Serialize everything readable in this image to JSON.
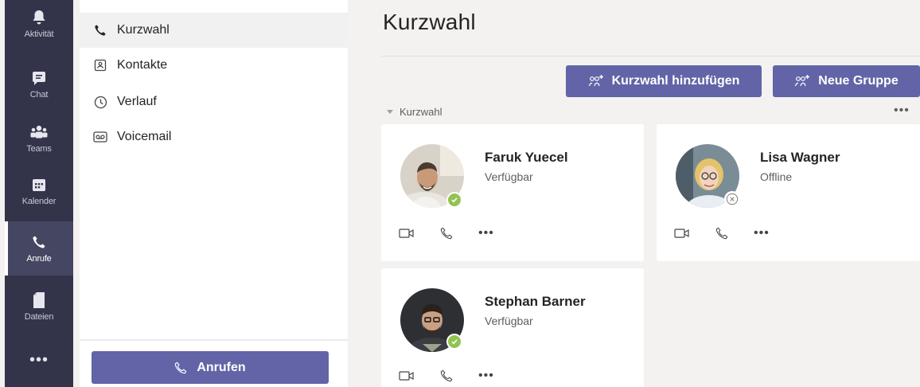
{
  "rail": {
    "items": [
      {
        "label": "Aktivität",
        "icon": "bell-icon"
      },
      {
        "label": "Chat",
        "icon": "chat-icon"
      },
      {
        "label": "Teams",
        "icon": "teams-icon"
      },
      {
        "label": "Kalender",
        "icon": "calendar-icon"
      },
      {
        "label": "Anrufe",
        "icon": "phone-icon",
        "active": true
      },
      {
        "label": "Dateien",
        "icon": "file-icon"
      }
    ],
    "more_label": "•••"
  },
  "nav": {
    "items": [
      {
        "label": "Kurzwahl",
        "icon": "phone-icon"
      },
      {
        "label": "Kontakte",
        "icon": "contact-card-icon"
      },
      {
        "label": "Verlauf",
        "icon": "clock-icon"
      },
      {
        "label": "Voicemail",
        "icon": "voicemail-icon"
      }
    ],
    "call_button_label": "Anrufen"
  },
  "main": {
    "title": "Kurzwahl",
    "add_speed_dial_label": "Kurzwahl hinzufügen",
    "new_group_label": "Neue Gruppe",
    "section_label": "Kurzwahl",
    "section_more": "•••",
    "contacts": [
      {
        "name": "Faruk Yuecel",
        "status": "Verfügbar",
        "presence": "available"
      },
      {
        "name": "Lisa Wagner",
        "status": "Offline",
        "presence": "offline"
      },
      {
        "name": "Stephan Barner",
        "status": "Verfügbar",
        "presence": "available"
      }
    ],
    "card_more": "•••"
  },
  "colors": {
    "rail_bg": "#33344a",
    "accent": "#6264a7",
    "available": "#92c353",
    "page_bg": "#f3f2f1"
  }
}
